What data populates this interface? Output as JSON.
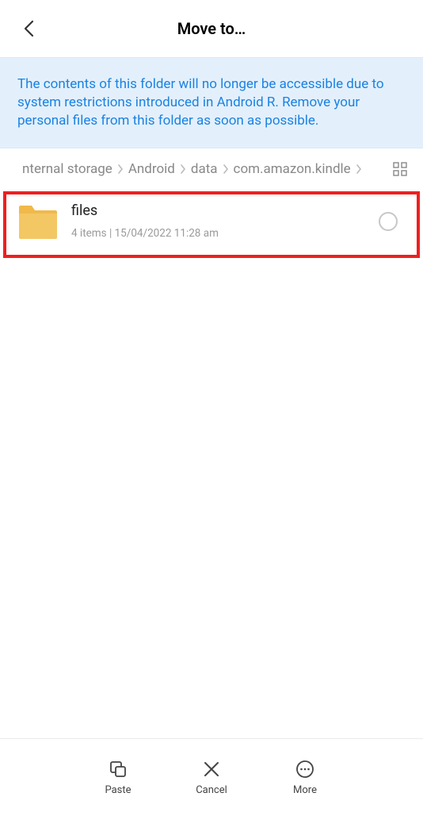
{
  "header": {
    "title": "Move to…"
  },
  "banner": {
    "text": "The contents of this folder will no longer be accessible due to system restrictions introduced in Android R. Remove your personal files from this folder as soon as possible."
  },
  "breadcrumb": {
    "items": [
      "nternal storage",
      "Android",
      "data",
      "com.amazon.kindle"
    ]
  },
  "list": {
    "items": [
      {
        "name": "files",
        "meta": "4 items  |  15/04/2022 11:28 am"
      }
    ]
  },
  "bottom": {
    "paste": "Paste",
    "cancel": "Cancel",
    "more": "More"
  }
}
